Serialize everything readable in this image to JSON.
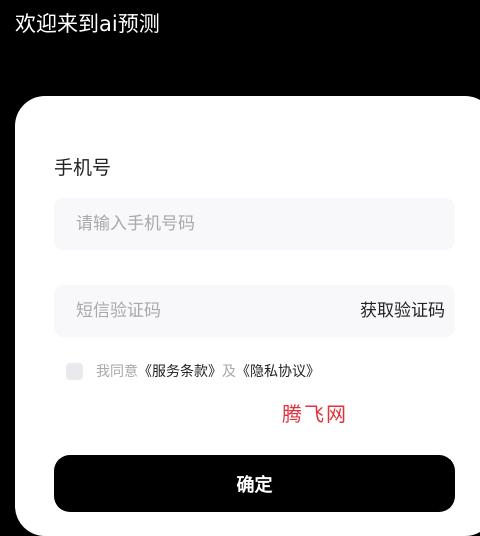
{
  "header": {
    "welcome_title": "欢迎来到ai预测"
  },
  "form": {
    "phone_label": "手机号",
    "phone_placeholder": "请输入手机号码",
    "phone_value": "",
    "code_placeholder": "短信验证码",
    "code_value": "",
    "get_code_label": "获取验证码"
  },
  "agreement": {
    "checked": false,
    "prefix": "我同意",
    "terms_link": "《服务条款》",
    "connector": "及",
    "privacy_link": "《隐私协议》"
  },
  "watermark": "腾飞网",
  "confirm_label": "确定",
  "colors": {
    "background": "#000000",
    "card": "#ffffff",
    "field_bg": "#f8f8fb",
    "watermark": "#e0323a",
    "button": "#000000"
  }
}
